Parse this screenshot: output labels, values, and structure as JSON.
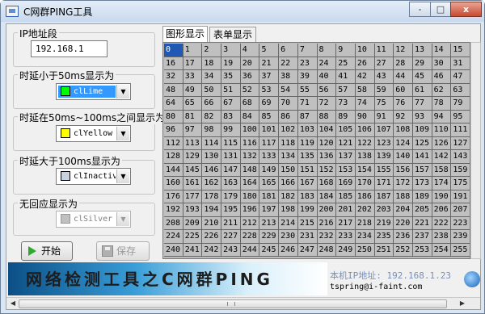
{
  "window": {
    "title": "C网群PING工具",
    "minimize_label": "-",
    "maximize_label": "□",
    "close_label": "x"
  },
  "left_panel": {
    "ip_group_label": "IP地址段",
    "ip_value": "192.168.1",
    "fast_group_label": "时延小于50ms显示为",
    "fast_color_name": "clLime",
    "fast_color": "#00ff00",
    "mid_group_label": "时延在50ms~100ms之间显示为",
    "mid_color_name": "clYellow",
    "mid_color": "#ffff00",
    "slow_group_label": "时延大于100ms显示为",
    "slow_color_name": "clInactiv",
    "slow_color": "#c9d3e0",
    "none_group_label": "无回应显示为",
    "none_color_name": "clSilver",
    "none_color": "#c0c0c0",
    "start_label": "开始",
    "save_label": "保存"
  },
  "tabs": [
    {
      "label": "图形显示",
      "active": true
    },
    {
      "label": "表单显示",
      "active": false
    }
  ],
  "grid": {
    "selected_cell": "0",
    "cell_color": "#c0c0c0",
    "selected_color": "#1f59b4"
  },
  "banner": {
    "text": "网络检测工具之C网群PING",
    "local_ip": "本机IP地址: 192.168.1.23",
    "email": "tspring@i-faint.com"
  }
}
